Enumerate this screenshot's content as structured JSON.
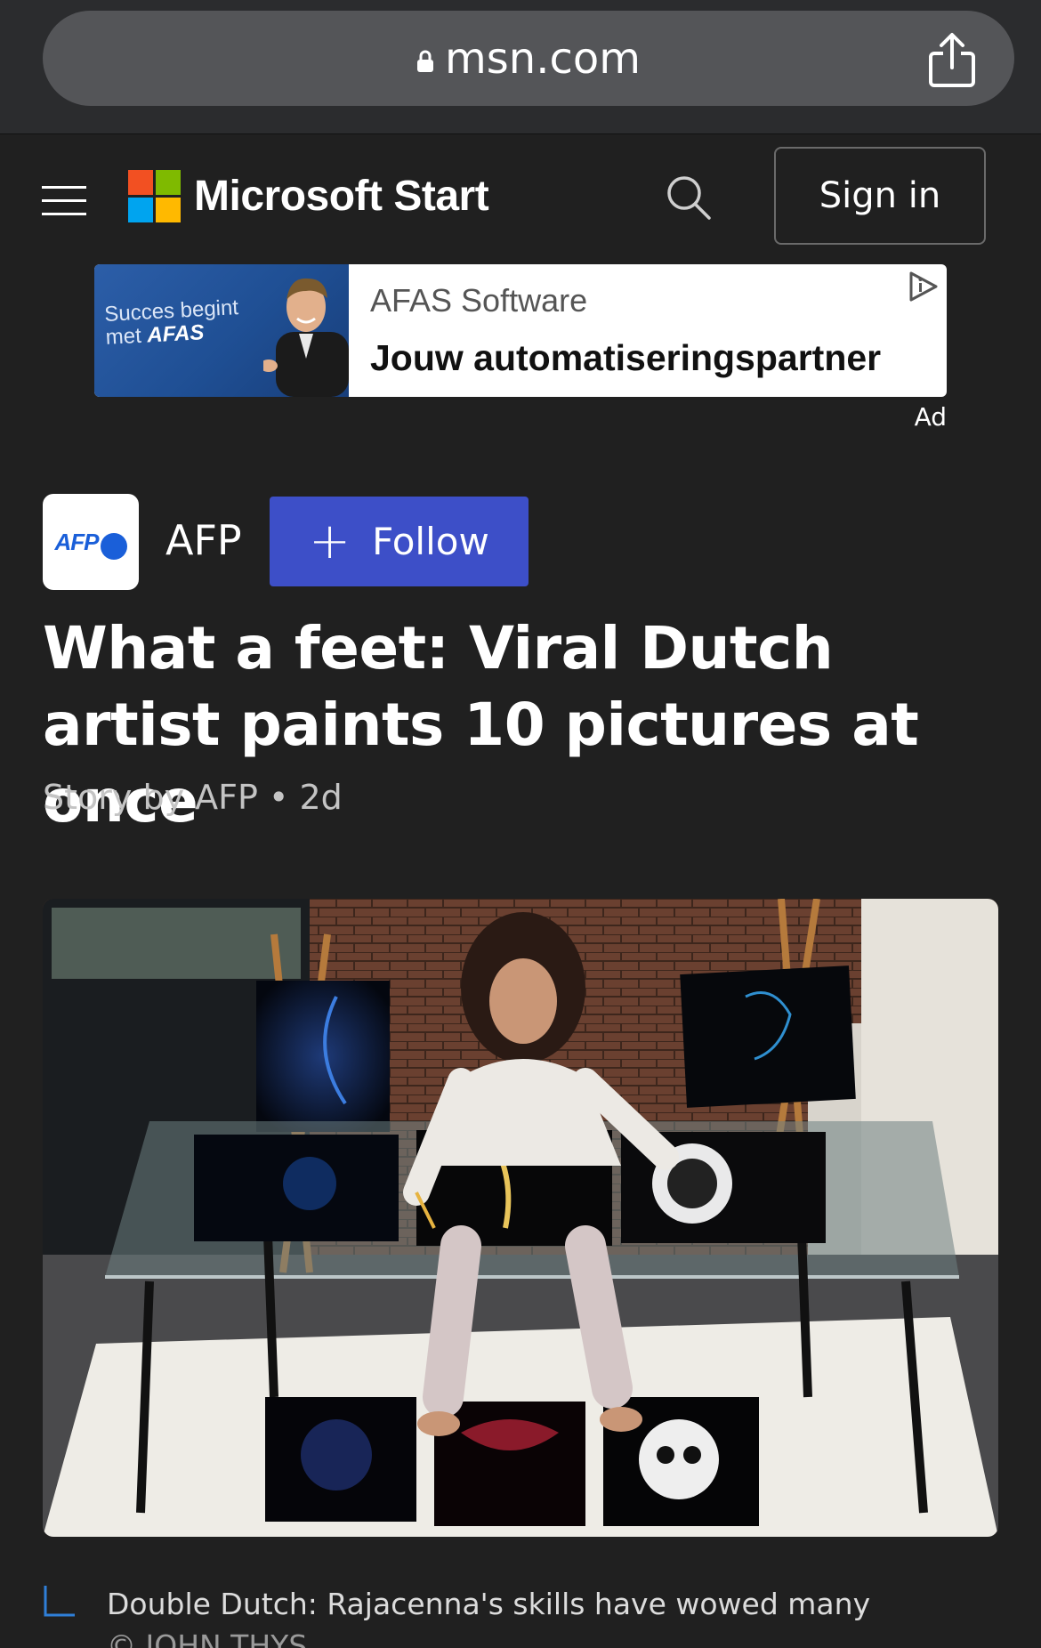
{
  "browser": {
    "url": "msn.com"
  },
  "header": {
    "brand": "Microsoft Start",
    "sign_in_label": "Sign in"
  },
  "ad": {
    "image_line1": "Succes begint",
    "image_line2_prefix": "met ",
    "image_line2_brand": "AFAS",
    "advertiser": "AFAS Software",
    "headline": "Jouw automatiseringspartner",
    "label": "Ad"
  },
  "publisher": {
    "logo_text": "AFP",
    "name": "AFP",
    "follow_label": "Follow"
  },
  "article": {
    "headline": "What a feet: Viral Dutch artist paints 10 pictures at once",
    "byline": "Story by AFP • 2d",
    "caption": "Double Dutch: Rajacenna's skills have wowed many",
    "credit": "© JOHN THYS"
  },
  "colors": {
    "background": "#202020",
    "follow_button": "#3d4fc8",
    "ms_red": "#f25022",
    "ms_green": "#7fba00",
    "ms_blue": "#00a4ef",
    "ms_yellow": "#ffb900",
    "caption_accent": "#2f7fd8"
  }
}
